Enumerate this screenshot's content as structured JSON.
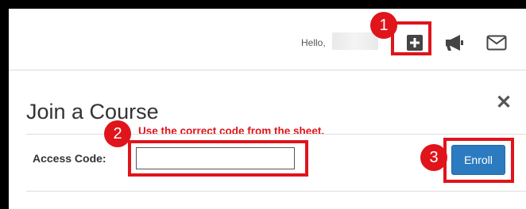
{
  "header": {
    "greeting": "Hello,",
    "icons": [
      "add-course-icon",
      "announcement-icon",
      "mail-icon"
    ]
  },
  "callouts": {
    "step1": "1",
    "step2": "2",
    "step3": "3",
    "hint": "Use the correct code from the sheet."
  },
  "modal": {
    "title": "Join a Course",
    "close": "✕",
    "access_code_label": "Access Code:",
    "access_code_value": "",
    "enroll_label": "Enroll"
  },
  "colors": {
    "annotation_red": "#e0141b",
    "enroll_blue": "#2c7bc0"
  }
}
